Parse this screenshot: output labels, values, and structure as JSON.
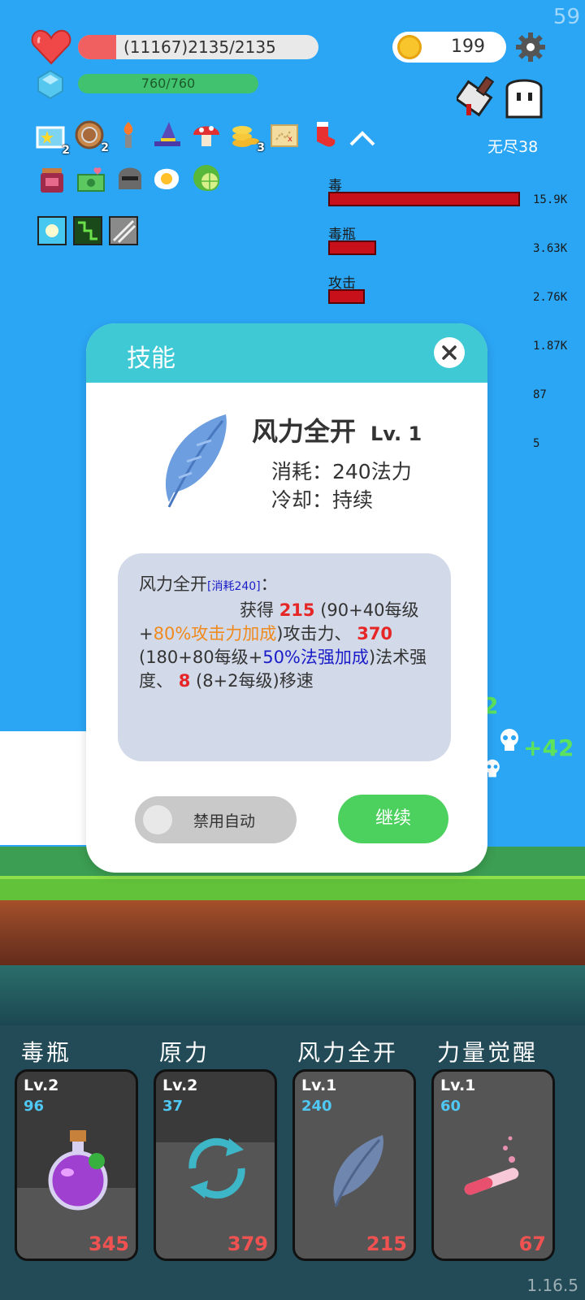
{
  "fps": "59",
  "version": "1.16.5",
  "player": {
    "hp_text": "(11167)2135/2135",
    "hp_fraction": 0.16,
    "mp_text": "760/760",
    "mp_fraction": 1.0,
    "heart_color": "#f04848",
    "gem_color": "#56c8f0"
  },
  "coins": {
    "value": "199",
    "icon": "coin-icon"
  },
  "mode": {
    "label": "无尽38"
  },
  "items": [
    {
      "name": "star-card-icon",
      "badge": "2"
    },
    {
      "name": "shield-icon",
      "badge": "2"
    },
    {
      "name": "torch-icon",
      "badge": ""
    },
    {
      "name": "wizard-hat-icon",
      "badge": ""
    },
    {
      "name": "mushroom-icon",
      "badge": ""
    },
    {
      "name": "coin-stack-icon",
      "badge": "3"
    },
    {
      "name": "treasure-map-icon",
      "badge": ""
    },
    {
      "name": "sock-icon",
      "badge": ""
    },
    {
      "name": "jam-jar-icon",
      "badge": ""
    },
    {
      "name": "money-icon",
      "badge": ""
    },
    {
      "name": "helmet-icon",
      "badge": ""
    },
    {
      "name": "egg-icon",
      "badge": ""
    },
    {
      "name": "lime-icon",
      "badge": ""
    }
  ],
  "damage_stats": [
    {
      "label": "毒",
      "value": "15.9K",
      "fraction": 1.0
    },
    {
      "label": "毒瓶",
      "value": "3.63K",
      "fraction": 0.25
    },
    {
      "label": "攻击",
      "value": "2.76K",
      "fraction": 0.19
    },
    {
      "label": "",
      "value": "1.87K",
      "fraction": 0.12
    },
    {
      "label": "",
      "value": "87",
      "fraction": 0.01
    },
    {
      "label": "",
      "value": "5",
      "fraction": 0.005
    }
  ],
  "float_texts": {
    "a": "+42",
    "b": "2"
  },
  "dialog": {
    "title": "技能",
    "skill_name": "风力全开",
    "skill_level": "Lv. 1",
    "cost_line": "消耗：240法力",
    "cooldown_line": "冷却：持续",
    "desc": {
      "title": "风力全开",
      "cost_tag": "[消耗240]",
      "colon": "：",
      "gain": "获得",
      "atk_value": "215",
      "atk_formula_a": "(90+40每级+",
      "atk_formula_b": "80%攻击力加成",
      "atk_formula_c": ")攻击力、",
      "sp_value": "370",
      "sp_formula_a": "(180+80每级+",
      "sp_formula_b": "50%法强加成",
      "sp_formula_c": ")法术强度、",
      "ms_value": "8",
      "ms_formula": "(8+2每级)移速"
    },
    "toggle_label": "禁用自动",
    "continue_label": "继续"
  },
  "skills": [
    {
      "name": "毒瓶",
      "level": "Lv.2",
      "cost": "96",
      "damage": "345",
      "icon": "poison-flask-icon",
      "cooldown_fill": 0.38
    },
    {
      "name": "原力",
      "level": "Lv.2",
      "cost": "37",
      "damage": "379",
      "icon": "refresh-icon",
      "cooldown_fill": 0.62
    },
    {
      "name": "风力全开",
      "level": "Lv.1",
      "cost": "240",
      "damage": "215",
      "icon": "feather-icon",
      "cooldown_fill": 1.0
    },
    {
      "name": "力量觉醒",
      "level": "Lv.1",
      "cost": "60",
      "damage": "67",
      "icon": "test-tube-icon",
      "cooldown_fill": 1.0
    }
  ]
}
